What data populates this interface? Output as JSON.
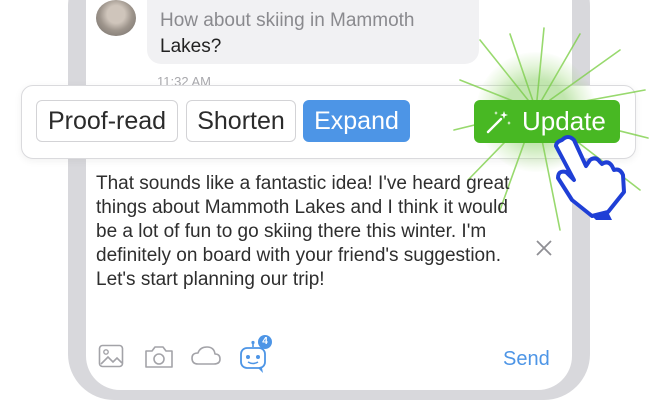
{
  "message": {
    "text_partial": "How about skiing in Mammoth",
    "text_rest": "Lakes?",
    "timestamp": "11:32 AM"
  },
  "toolbar": {
    "proofread_label": "Proof-read",
    "shorten_label": "Shorten",
    "expand_label": "Expand",
    "update_label": "Update",
    "accent": "#4d95e6",
    "update_color": "#48b823"
  },
  "reply": {
    "text": "That sounds like a fantastic idea! I've heard great things about Mammoth Lakes and I think it would be a lot of fun to go skiing there this winter. I'm definitely on board with your friend's suggestion. Let's start planning our trip!"
  },
  "composer": {
    "bot_badge": "4",
    "send_label": "Send"
  },
  "icons": [
    "image-icon",
    "camera-icon",
    "cloud-icon",
    "bot-icon",
    "close-icon",
    "magic-wand-icon",
    "pointing-hand-icon"
  ]
}
